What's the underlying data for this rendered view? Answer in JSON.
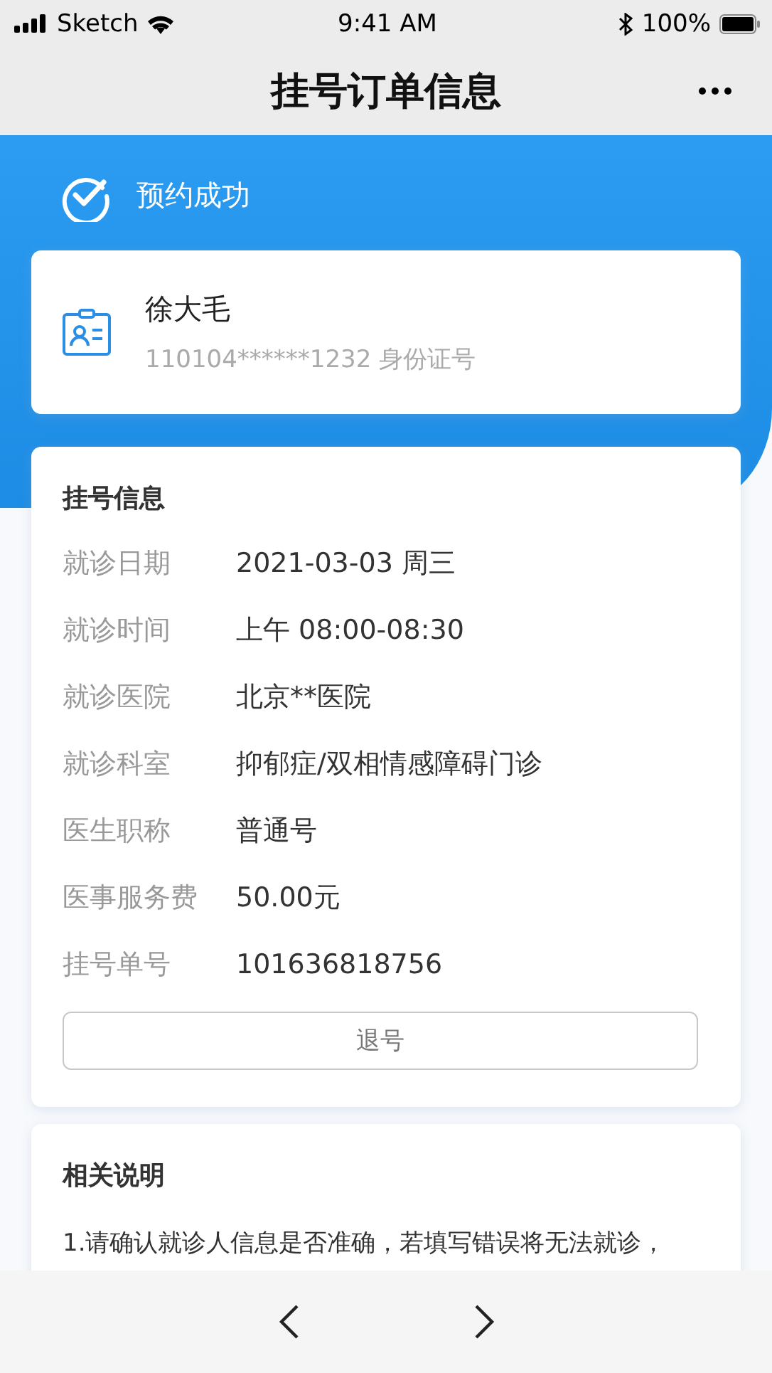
{
  "status_bar": {
    "carrier": "Sketch",
    "time": "9:41 AM",
    "battery": "100%"
  },
  "nav_bar": {
    "title": "挂号订单信息"
  },
  "banner": {
    "status": "预约成功"
  },
  "patient": {
    "name": "徐大毛",
    "id_number": "110104******1232 身份证号"
  },
  "registration": {
    "title": "挂号信息",
    "rows": [
      {
        "label": "就诊日期",
        "value": "2021-03-03 周三"
      },
      {
        "label": "就诊时间",
        "value": "上午 08:00-08:30"
      },
      {
        "label": "就诊医院",
        "value": "北京**医院"
      },
      {
        "label": "就诊科室",
        "value": "抑郁症/双相情感障碍门诊"
      },
      {
        "label": "医生职称",
        "value": "普通号"
      },
      {
        "label": "医事服务费",
        "value": "50.00元"
      },
      {
        "label": "挂号单号",
        "value": "101636818756"
      }
    ],
    "button": "退号"
  },
  "notes": {
    "title": "相关说明",
    "lines": [
      "1.请确认就诊人信息是否准确，若填写错误将无法就诊，"
    ]
  }
}
